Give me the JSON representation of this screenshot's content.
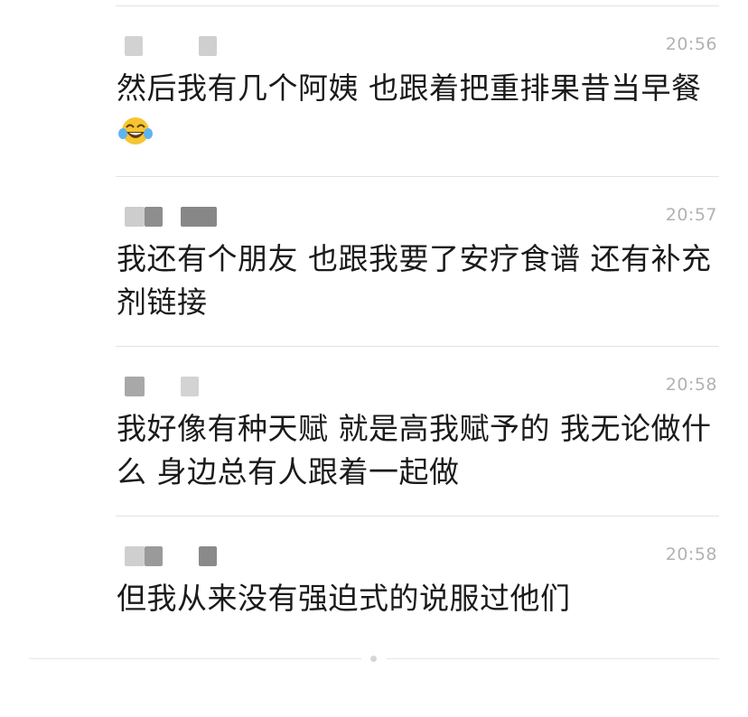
{
  "messages": [
    {
      "sender_masked": true,
      "time": "20:56",
      "text": "然后我有几个阿姨 也跟着把重排果昔当早餐",
      "emoji": "laughing-crying-face"
    },
    {
      "sender_masked": true,
      "time": "20:57",
      "text": "我还有个朋友 也跟我要了安疗食谱 还有补充剂链接"
    },
    {
      "sender_masked": true,
      "time": "20:58",
      "text": "我好像有种天赋 就是高我赋予的 我无论做什么 身边总有人跟着一起做"
    },
    {
      "sender_masked": true,
      "time": "20:58",
      "text": "但我从来没有强迫式的说服过他们"
    }
  ],
  "colors": {
    "text": "#1a1a1a",
    "time": "#b2b2b2",
    "divider": "#e3e3e3",
    "mask_light": "#d0d0d0",
    "mask_dark": "#8a8a8a",
    "emoji_face": "#f7c531"
  }
}
